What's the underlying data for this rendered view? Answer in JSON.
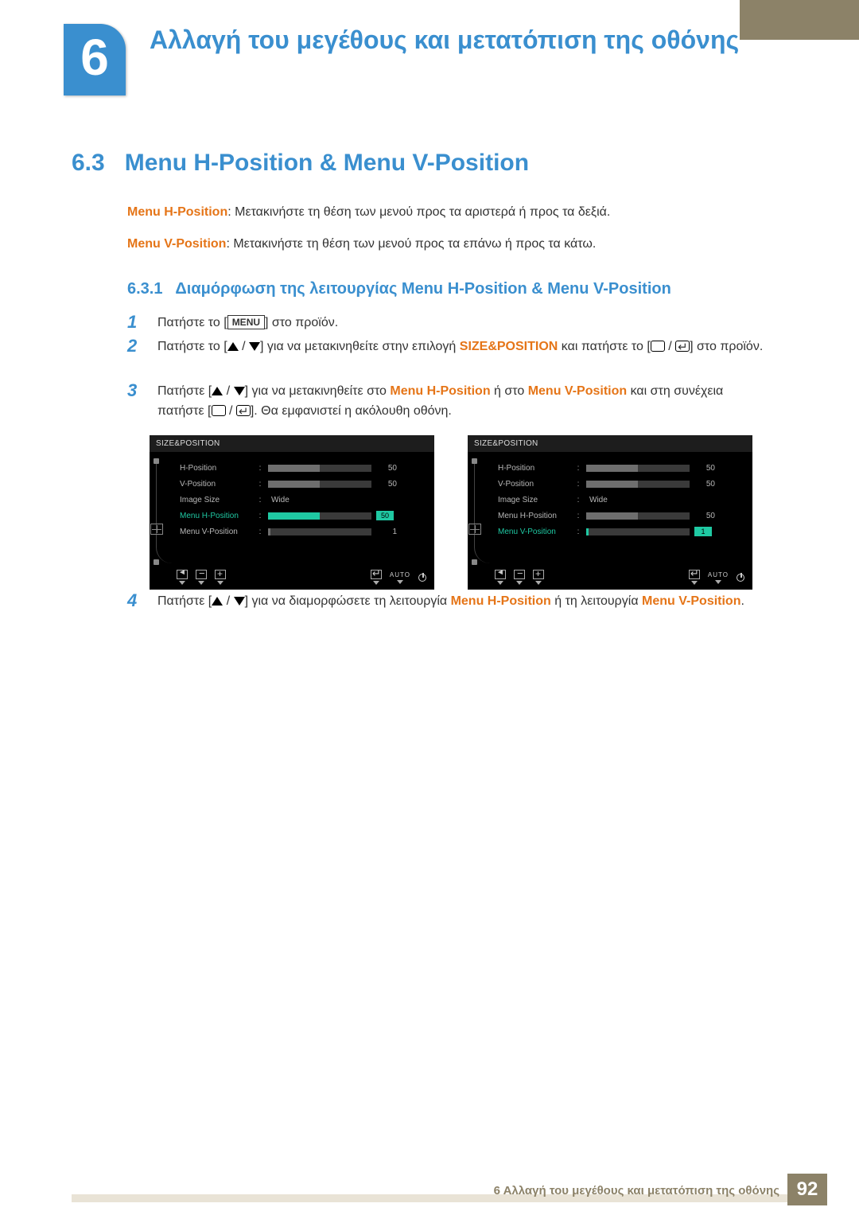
{
  "chapter": {
    "number": "6",
    "title": "Αλλαγή του μεγέθους και μετατόπιση της οθόνης"
  },
  "section": {
    "num": "6.3",
    "title": "Menu H-Position & Menu V-Position"
  },
  "intro": {
    "h_label": "Menu H-Position",
    "h_text": ": Μετακινήστε τη θέση των μενού προς τα αριστερά ή προς τα δεξιά.",
    "v_label": "Menu V-Position",
    "v_text": ": Μετακινήστε τη θέση των μενού προς τα επάνω ή προς τα κάτω."
  },
  "subsection": {
    "num": "6.3.1",
    "title": "Διαμόρφωση της λειτουργίας Menu H-Position & Menu V-Position"
  },
  "steps": {
    "s1_a": "Πατήστε το [",
    "s1_menu": "MENU",
    "s1_b": "] στο προϊόν.",
    "s2_a": "Πατήστε το [",
    "s2_b": "] για να μετακινηθείτε στην επιλογή ",
    "s2_size": "SIZE&POSITION",
    "s2_c": " και πατήστε το [",
    "s2_d": "] στο προϊόν.",
    "s3_a": "Πατήστε [",
    "s3_b": "] για να μετακινηθείτε στο ",
    "s3_h": "Menu H-Position",
    "s3_or": " ή στο ",
    "s3_v": "Menu V-Position",
    "s3_c": " και στη συνέχεια πατήστε [",
    "s3_d": "]. Θα εμφανιστεί η ακόλουθη οθόνη.",
    "s4_a": "Πατήστε [",
    "s4_b": "] για να διαμορφώσετε τη λειτουργία ",
    "s4_h": "Menu H-Position",
    "s4_or": " ή τη λειτουργία ",
    "s4_v": "Menu V-Position",
    "s4_c": "."
  },
  "osd": {
    "title": "SIZE&POSITION",
    "items": [
      {
        "label": "H-Position",
        "value": "50",
        "fill": 50
      },
      {
        "label": "V-Position",
        "value": "50",
        "fill": 50
      },
      {
        "label": "Image Size",
        "text": "Wide"
      },
      {
        "label": "Menu H-Position",
        "value": "50",
        "fill": 50
      },
      {
        "label": "Menu V-Position",
        "value": "1",
        "fill": 2
      }
    ],
    "auto": "AUTO",
    "left_selected_idx": 3,
    "right_selected_idx": 4
  },
  "footer": {
    "text": "6 Αλλαγή του μεγέθους και μετατόπιση της οθόνης",
    "page": "92"
  }
}
